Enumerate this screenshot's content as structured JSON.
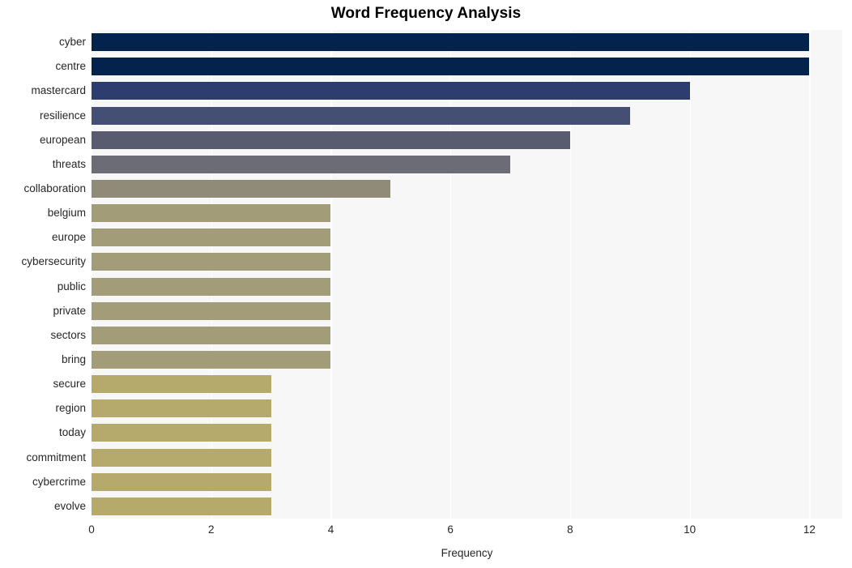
{
  "chart_data": {
    "type": "bar",
    "orientation": "horizontal",
    "title": "Word Frequency Analysis",
    "xlabel": "Frequency",
    "ylabel": "",
    "categories": [
      "cyber",
      "centre",
      "mastercard",
      "resilience",
      "european",
      "threats",
      "collaboration",
      "belgium",
      "europe",
      "cybersecurity",
      "public",
      "private",
      "sectors",
      "bring",
      "secure",
      "region",
      "today",
      "commitment",
      "cybercrime",
      "evolve"
    ],
    "values": [
      12,
      12,
      10,
      9,
      8,
      7,
      5,
      4,
      4,
      4,
      4,
      4,
      4,
      4,
      3,
      3,
      3,
      3,
      3,
      3
    ],
    "bar_colors": [
      "#04234c",
      "#04234c",
      "#2d3d6e",
      "#454f73",
      "#585c6e",
      "#6b6c75",
      "#908b78",
      "#a39c78",
      "#a39c78",
      "#a39c78",
      "#a39c78",
      "#a39c78",
      "#a39c78",
      "#a39c78",
      "#b5aa6b",
      "#b5aa6b",
      "#b5aa6b",
      "#b5aa6b",
      "#b5aa6b",
      "#b5aa6b"
    ],
    "xticks": [
      0,
      2,
      4,
      6,
      8,
      10,
      12
    ],
    "xlim": [
      0,
      12.55
    ],
    "grid": true,
    "grid_color": "#ffffff",
    "plot_background": "#f7f7f7",
    "figure_background": "#ffffff",
    "legend": null
  }
}
